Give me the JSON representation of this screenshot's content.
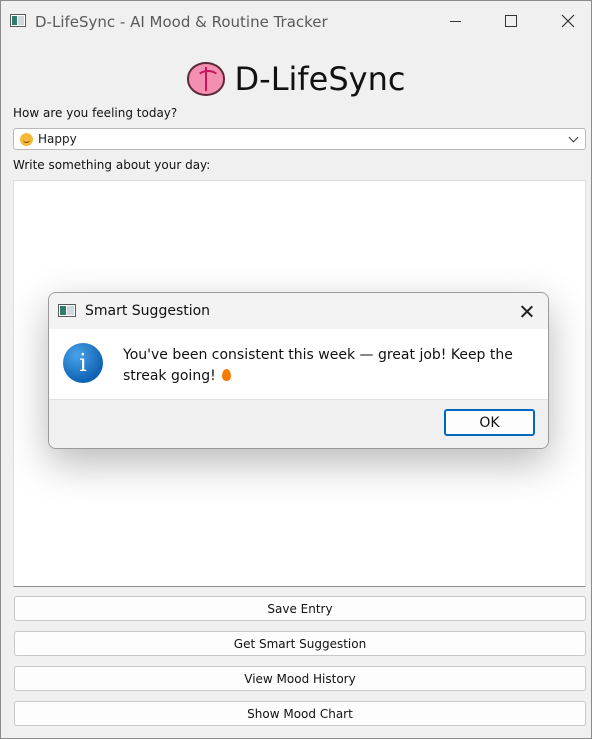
{
  "window": {
    "title": "D-LifeSync - AI Mood & Routine Tracker"
  },
  "header": {
    "icon": "brain-emoji-icon",
    "title": "D-LifeSync"
  },
  "mood": {
    "label": "How are you feeling today?",
    "selected_emoji": "smiling-face-icon",
    "selected_value": "Happy"
  },
  "journal": {
    "label": "Write something about your day:",
    "value": ""
  },
  "buttons": {
    "save": "Save Entry",
    "suggestion": "Get Smart Suggestion",
    "history": "View Mood History",
    "chart": "Show Mood Chart"
  },
  "dialog": {
    "title": "Smart Suggestion",
    "icon": "info-icon",
    "message": "You've been consistent this week — great job! Keep the streak going!",
    "message_emoji": "fire-icon",
    "ok_label": "OK"
  }
}
